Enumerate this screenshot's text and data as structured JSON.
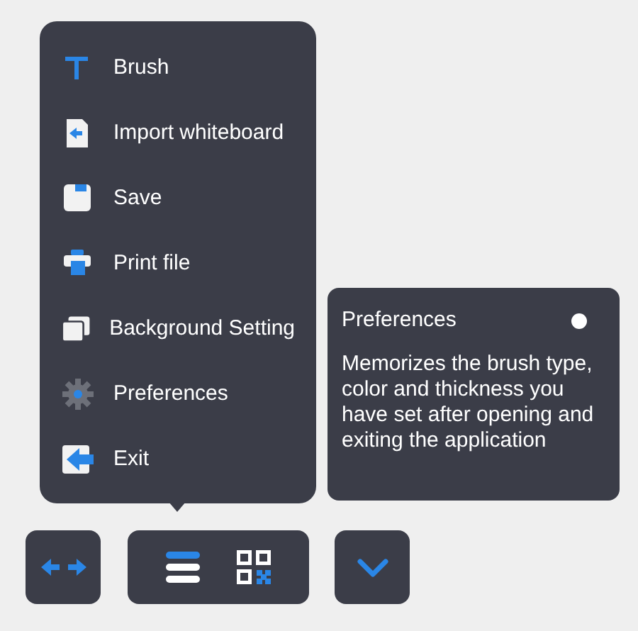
{
  "menu": {
    "items": [
      {
        "label": "Brush"
      },
      {
        "label": "Import whiteboard"
      },
      {
        "label": "Save"
      },
      {
        "label": "Print file"
      },
      {
        "label": "Background Setting"
      },
      {
        "label": "Preferences"
      },
      {
        "label": "Exit"
      }
    ]
  },
  "tooltip": {
    "title": "Preferences",
    "description": "Memorizes the brush type, color and thickness you have set after opening and exiting the application"
  }
}
